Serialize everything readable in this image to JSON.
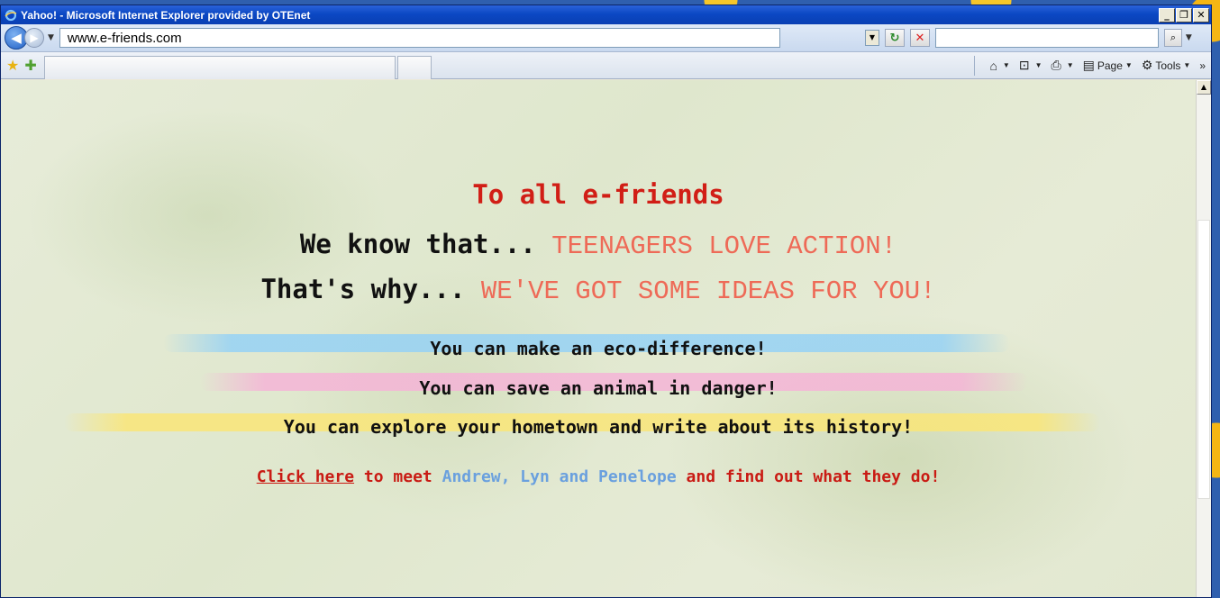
{
  "window": {
    "title": "Yahoo! - Microsoft Internet Explorer provided by OTEnet",
    "minimize": "_",
    "maximize": "❐",
    "close": "✕"
  },
  "address_bar": {
    "url": "www.e-friends.com",
    "back_icon": "back-arrow-icon",
    "forward_icon": "forward-arrow-icon",
    "refresh": "↻",
    "stop": "✕",
    "search_value": "",
    "search_go": "⌕"
  },
  "command_bar": {
    "home": "⌂",
    "feeds": "⊡",
    "print": "⎙",
    "page_label": "Page",
    "tools_label": "Tools",
    "more": "»"
  },
  "content": {
    "heading": "To all e-friends",
    "line2_prefix": "We know that... ",
    "line2_accent": "TEENAGERS LOVE ACTION!",
    "line3_prefix": "That's why... ",
    "line3_accent": "WE'VE GOT SOME IDEAS FOR YOU!",
    "ideas": [
      "You can make an eco-difference!",
      "You can save an animal in danger!",
      "You can explore your hometown and write about its history!"
    ],
    "cta_link": "Click here",
    "cta_mid": " to meet ",
    "cta_names": "Andrew, Lyn and Penelope",
    "cta_end": " and find out what they do!"
  },
  "colors": {
    "heading_red": "#d11e16",
    "accent_coral": "#ee6a57",
    "names_blue": "#6aa0de",
    "title_bar_blue": "#0b48c4"
  }
}
